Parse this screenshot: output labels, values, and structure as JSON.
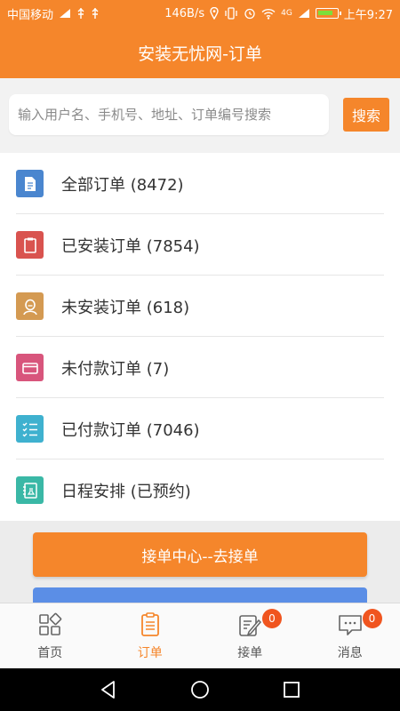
{
  "status_bar": {
    "carrier": "中国移动",
    "speed": "146B/s",
    "network": "4G",
    "time": "上午9:27"
  },
  "title": "安装无忧网-订单",
  "search": {
    "placeholder": "输入用户名、手机号、地址、订单编号搜索",
    "button_label": "搜索"
  },
  "order_items": [
    {
      "label": "全部订单 (8472)",
      "icon": "document-icon",
      "color": "#4a86cf"
    },
    {
      "label": "已安装订单 (7854)",
      "icon": "clipboard-icon",
      "color": "#d9534f"
    },
    {
      "label": "未安装订单 (618)",
      "icon": "person-icon",
      "color": "#d49a52"
    },
    {
      "label": "未付款订单 (7)",
      "icon": "card-icon",
      "color": "#d8557c"
    },
    {
      "label": "已付款订单 (7046)",
      "icon": "checklist-icon",
      "color": "#3fb1cf"
    },
    {
      "label": "日程安排 (已预约)",
      "icon": "schedule-icon",
      "color": "#3ab8a6"
    }
  ],
  "actions": {
    "receive_label": "接单中心--去接单"
  },
  "tabs": [
    {
      "label": "首页",
      "icon": "grid-icon",
      "badge": ""
    },
    {
      "label": "订单",
      "icon": "order-list-icon",
      "badge": ""
    },
    {
      "label": "接单",
      "icon": "edit-note-icon",
      "badge": "0"
    },
    {
      "label": "消息",
      "icon": "message-icon",
      "badge": "0"
    }
  ],
  "colors": {
    "brand": "#f5862b",
    "badge": "#f0551f",
    "secondary_button": "#5b8ee6"
  }
}
